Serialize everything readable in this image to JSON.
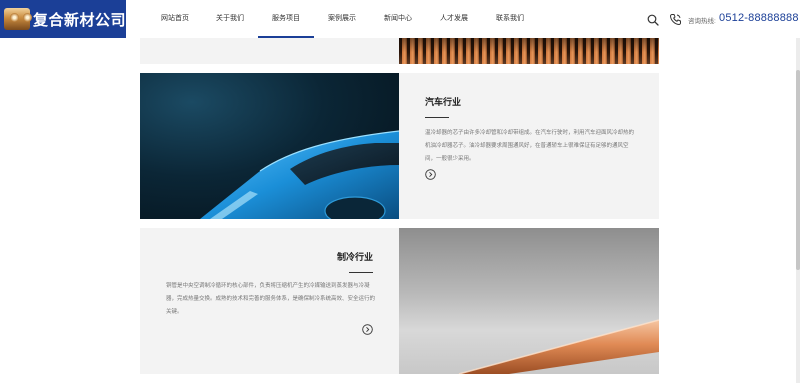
{
  "brand": {
    "name": "复合新材公司"
  },
  "nav": {
    "items": [
      {
        "label": "网站首页"
      },
      {
        "label": "关于我们"
      },
      {
        "label": "服务项目"
      },
      {
        "label": "案例展示"
      },
      {
        "label": "新闻中心"
      },
      {
        "label": "人才发展"
      },
      {
        "label": "联系我们"
      }
    ],
    "active_index": 2
  },
  "header": {
    "search_icon": "search-icon",
    "phone_icon": "phone-icon",
    "hotline_label": "咨询热线:",
    "hotline_number": "0512-88888888",
    "accent_color": "#1b3f97"
  },
  "sections": {
    "automotive": {
      "title": "汽车行业",
      "description": "温冷却器的芯子由许多冷却管和冷却带组成。在汽车行驶时，利用汽车迎面风冷却热的机油冷却器芯子。油冷却器要求周围通风好，在普通轿车上很难保证有足够的通风空间，一般很少采用。",
      "more_icon": "arrow-right-circle-icon"
    },
    "refrigeration": {
      "title": "制冷行业",
      "description": "铜管是中央空调制冷循环的核心部件，负责将压缩机产生的冷媒输送到蒸发器与冷凝器，完成热量交换。成熟的技术和完善的服务体系，是确保制冷系统高效、安全运行的关键。",
      "more_icon": "arrow-right-circle-icon"
    }
  }
}
